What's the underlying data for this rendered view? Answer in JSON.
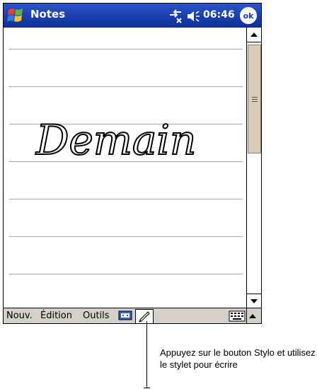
{
  "titlebar": {
    "app_title": "Notes",
    "clock": "06:46",
    "ok_label": "ok",
    "icons": [
      "start-flag-icon",
      "connectivity-icon",
      "volume-icon"
    ]
  },
  "note": {
    "handwriting": "Demain"
  },
  "toolbar": {
    "menu_new": "Nouv.",
    "menu_edit": "Édition",
    "menu_tools": "Outils",
    "icons": [
      "recording-icon",
      "pen-icon",
      "keyboard-icon",
      "input-arrow-up-icon"
    ]
  },
  "callout": {
    "text": "Appuyez sur le bouton Stylo  et utilisez le stylet pour écrire"
  },
  "colors": {
    "titlebar": "#1a3fb0",
    "toolbar": "#d4d0c8",
    "scroll_thumb": "#d8ccb8"
  }
}
